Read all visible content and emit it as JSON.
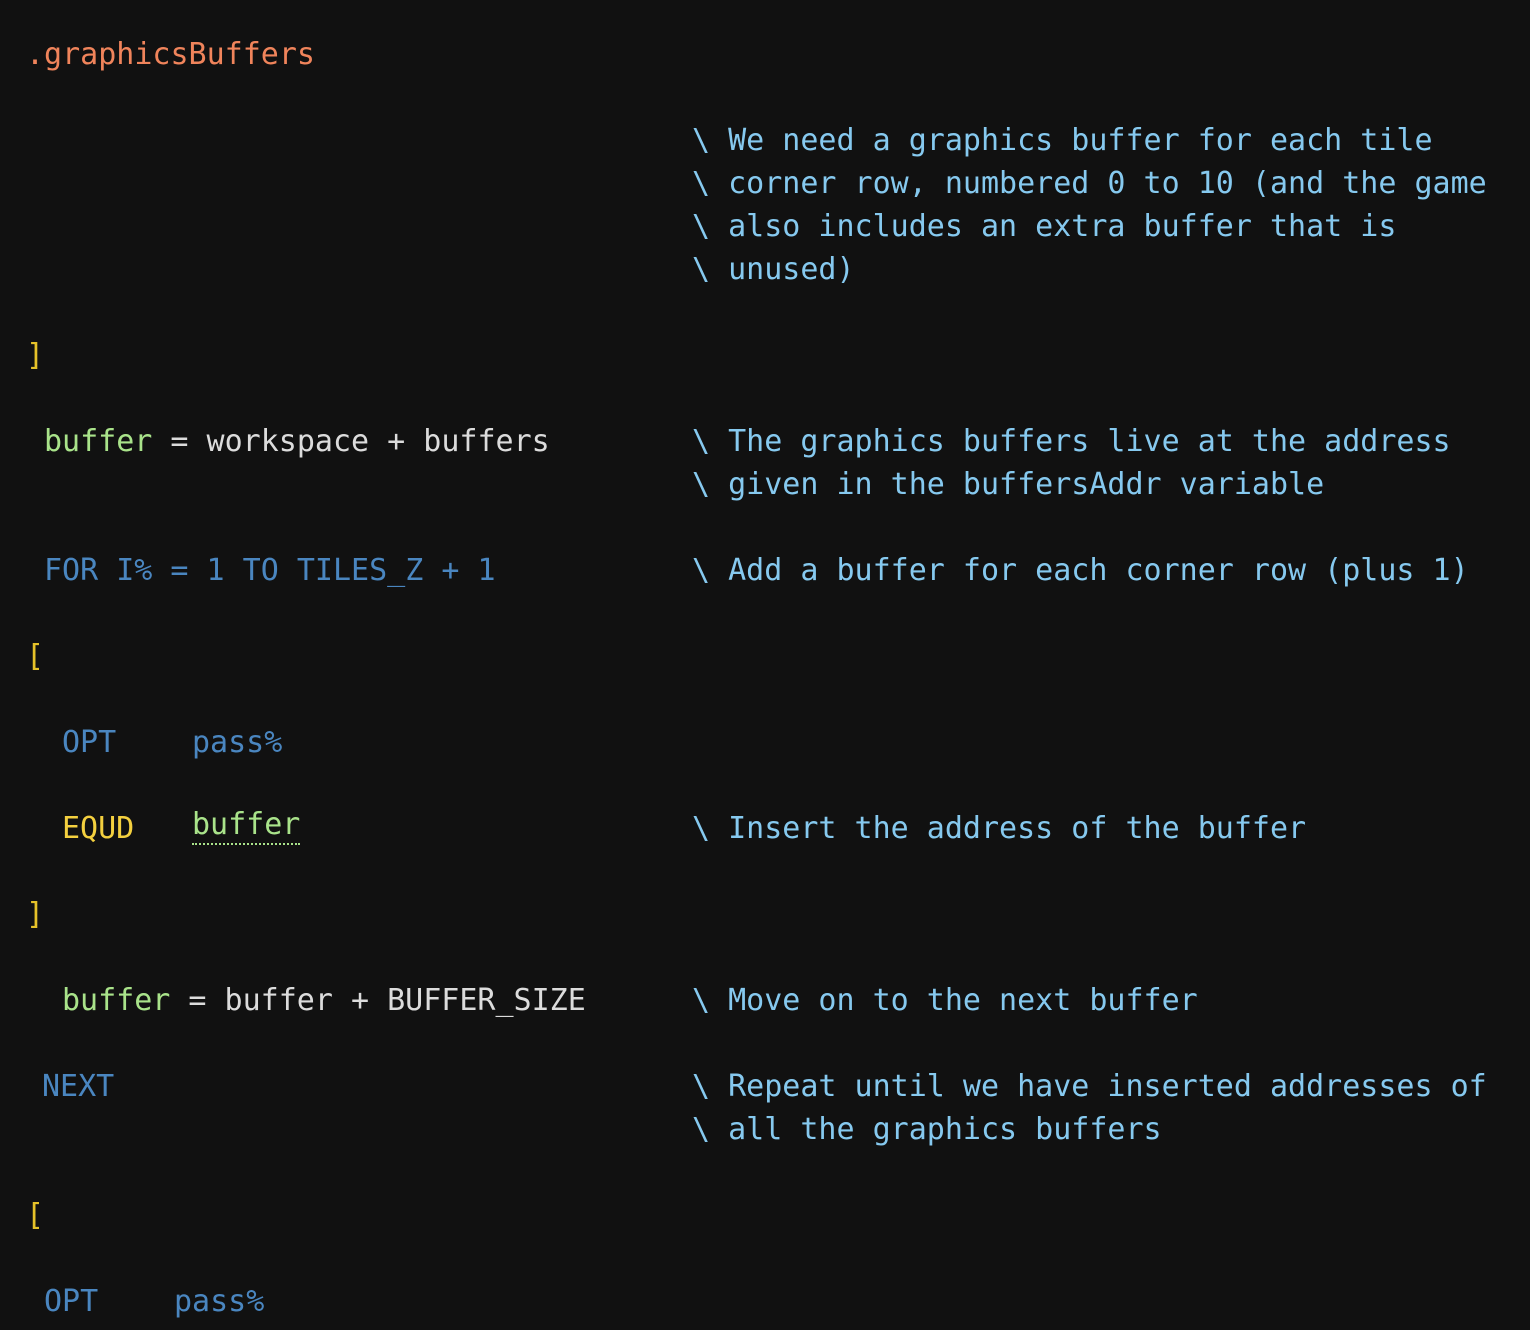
{
  "code": {
    "label_graphics_buffers": ".graphicsBuffers",
    "comment_block_1": [
      "\\ We need a graphics buffer for each tile",
      "\\ corner row, numbered 0 to 10 (and the game",
      "\\ also includes an extra buffer that is",
      "\\ unused)"
    ],
    "close_bracket": "]",
    "open_bracket": "[",
    "assign1": {
      "target": "buffer",
      "rest": " = workspace + buffers"
    },
    "comment_block_2": [
      "\\ The graphics buffers live at the address",
      "\\ given in the buffersAddr variable"
    ],
    "for_statement": "FOR I% = 1 TO TILES_Z + 1",
    "comment_for": "\\ Add a buffer for each corner row (plus 1)",
    "opt_keyword": "OPT",
    "opt_arg": "pass%",
    "equd_keyword": "EQUD",
    "equd_arg": "buffer",
    "comment_equd": "\\ Insert the address of the buffer",
    "assign2": {
      "target": "buffer",
      "rest": " = buffer + BUFFER_SIZE"
    },
    "comment_assign2": "\\ Move on to the next buffer",
    "next_keyword": "NEXT",
    "comment_next": [
      "\\ Repeat until we have inserted addresses of",
      "\\ all the graphics buffers"
    ]
  },
  "colors": {
    "background": "#111111",
    "label": "#f0845b",
    "bracket": "#e6c229",
    "variable": "#a9e38a",
    "plain": "#dcdcdc",
    "keyword": "#4a86c0",
    "directive": "#f4d03f",
    "comment": "#86c9ef"
  }
}
